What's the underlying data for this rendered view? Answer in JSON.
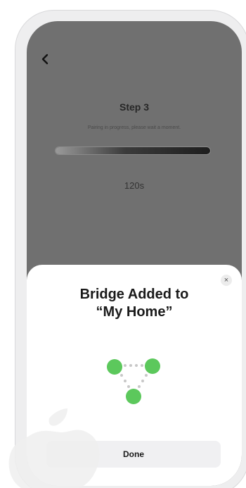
{
  "pairing": {
    "back_icon": "chevron-left-icon",
    "step_title": "Step 3",
    "subtitle": "Pairing in progress, please wait a moment.",
    "progress_percent": 100,
    "countdown": "120s"
  },
  "sheet": {
    "title_line1": "Bridge Added to",
    "title_line2": "“My Home”",
    "close_symbol": "×",
    "close_icon": "close-icon",
    "graphic_icon": "bridge-network-icon",
    "done_label": "Done"
  },
  "colors": {
    "accent_green": "#5cc85c",
    "overlay_gray": "#707070",
    "sheet_bg": "#ffffff",
    "button_bg": "#f0f0f2"
  }
}
